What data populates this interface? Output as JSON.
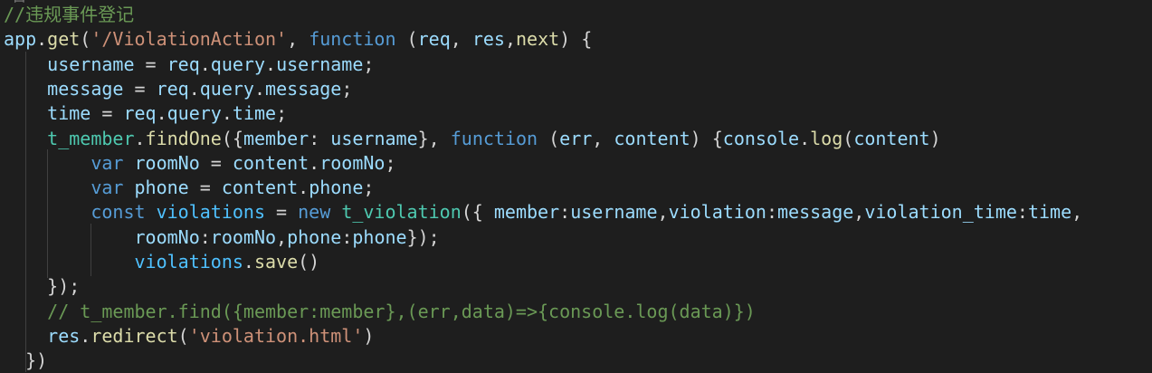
{
  "editor": {
    "top_artifact": "⌐口",
    "lines": [
      {
        "tokens": [
          {
            "t": "//违规事件登记",
            "c": "comment"
          }
        ]
      },
      {
        "tokens": [
          {
            "t": "app",
            "c": "var"
          },
          {
            "t": ".",
            "c": "punc"
          },
          {
            "t": "get",
            "c": "fn"
          },
          {
            "t": "(",
            "c": "punc"
          },
          {
            "t": "'/ViolationAction'",
            "c": "str"
          },
          {
            "t": ", ",
            "c": "punc"
          },
          {
            "t": "function",
            "c": "kw"
          },
          {
            "t": " (",
            "c": "punc"
          },
          {
            "t": "req",
            "c": "param"
          },
          {
            "t": ", ",
            "c": "punc"
          },
          {
            "t": "res",
            "c": "param"
          },
          {
            "t": ",",
            "c": "punc"
          },
          {
            "t": "next",
            "c": "fn"
          },
          {
            "t": ") {",
            "c": "punc"
          }
        ]
      },
      {
        "tokens": [
          {
            "t": "    ",
            "c": "punc"
          },
          {
            "t": "username",
            "c": "var"
          },
          {
            "t": " = ",
            "c": "punc"
          },
          {
            "t": "req",
            "c": "var"
          },
          {
            "t": ".",
            "c": "punc"
          },
          {
            "t": "query",
            "c": "var"
          },
          {
            "t": ".",
            "c": "punc"
          },
          {
            "t": "username",
            "c": "var"
          },
          {
            "t": ";",
            "c": "punc"
          }
        ]
      },
      {
        "tokens": [
          {
            "t": "    ",
            "c": "punc"
          },
          {
            "t": "message",
            "c": "var"
          },
          {
            "t": " = ",
            "c": "punc"
          },
          {
            "t": "req",
            "c": "var"
          },
          {
            "t": ".",
            "c": "punc"
          },
          {
            "t": "query",
            "c": "var"
          },
          {
            "t": ".",
            "c": "punc"
          },
          {
            "t": "message",
            "c": "var"
          },
          {
            "t": ";",
            "c": "punc"
          }
        ]
      },
      {
        "tokens": [
          {
            "t": "    ",
            "c": "punc"
          },
          {
            "t": "time",
            "c": "var"
          },
          {
            "t": " = ",
            "c": "punc"
          },
          {
            "t": "req",
            "c": "var"
          },
          {
            "t": ".",
            "c": "punc"
          },
          {
            "t": "query",
            "c": "var"
          },
          {
            "t": ".",
            "c": "punc"
          },
          {
            "t": "time",
            "c": "var"
          },
          {
            "t": ";",
            "c": "punc"
          }
        ]
      },
      {
        "tokens": [
          {
            "t": "    ",
            "c": "punc"
          },
          {
            "t": "t_member",
            "c": "type"
          },
          {
            "t": ".",
            "c": "punc"
          },
          {
            "t": "findOne",
            "c": "fn"
          },
          {
            "t": "({",
            "c": "punc"
          },
          {
            "t": "member",
            "c": "var"
          },
          {
            "t": ": ",
            "c": "punc"
          },
          {
            "t": "username",
            "c": "var"
          },
          {
            "t": "}, ",
            "c": "punc"
          },
          {
            "t": "function",
            "c": "kw"
          },
          {
            "t": " (",
            "c": "punc"
          },
          {
            "t": "err",
            "c": "param"
          },
          {
            "t": ", ",
            "c": "punc"
          },
          {
            "t": "content",
            "c": "param"
          },
          {
            "t": ") {",
            "c": "punc"
          },
          {
            "t": "console",
            "c": "var"
          },
          {
            "t": ".",
            "c": "punc"
          },
          {
            "t": "log",
            "c": "fn"
          },
          {
            "t": "(",
            "c": "punc"
          },
          {
            "t": "content",
            "c": "var"
          },
          {
            "t": ")",
            "c": "punc"
          }
        ]
      },
      {
        "tokens": [
          {
            "t": "        ",
            "c": "punc"
          },
          {
            "t": "var",
            "c": "kw"
          },
          {
            "t": " ",
            "c": "punc"
          },
          {
            "t": "roomNo",
            "c": "var"
          },
          {
            "t": " = ",
            "c": "punc"
          },
          {
            "t": "content",
            "c": "var"
          },
          {
            "t": ".",
            "c": "punc"
          },
          {
            "t": "roomNo",
            "c": "var"
          },
          {
            "t": ";",
            "c": "punc"
          }
        ]
      },
      {
        "tokens": [
          {
            "t": "        ",
            "c": "punc"
          },
          {
            "t": "var",
            "c": "kw"
          },
          {
            "t": " ",
            "c": "punc"
          },
          {
            "t": "phone",
            "c": "var"
          },
          {
            "t": " = ",
            "c": "punc"
          },
          {
            "t": "content",
            "c": "var"
          },
          {
            "t": ".",
            "c": "punc"
          },
          {
            "t": "phone",
            "c": "var"
          },
          {
            "t": ";",
            "c": "punc"
          }
        ]
      },
      {
        "tokens": [
          {
            "t": "        ",
            "c": "punc"
          },
          {
            "t": "const",
            "c": "kw"
          },
          {
            "t": " ",
            "c": "punc"
          },
          {
            "t": "violations",
            "c": "const"
          },
          {
            "t": " = ",
            "c": "punc"
          },
          {
            "t": "new",
            "c": "kw"
          },
          {
            "t": " ",
            "c": "punc"
          },
          {
            "t": "t_violation",
            "c": "type"
          },
          {
            "t": "({ ",
            "c": "punc"
          },
          {
            "t": "member",
            "c": "var"
          },
          {
            "t": ":",
            "c": "punc"
          },
          {
            "t": "username",
            "c": "var"
          },
          {
            "t": ",",
            "c": "punc"
          },
          {
            "t": "violation",
            "c": "var"
          },
          {
            "t": ":",
            "c": "punc"
          },
          {
            "t": "message",
            "c": "var"
          },
          {
            "t": ",",
            "c": "punc"
          },
          {
            "t": "violation_time",
            "c": "var"
          },
          {
            "t": ":",
            "c": "punc"
          },
          {
            "t": "time",
            "c": "var"
          },
          {
            "t": ",",
            "c": "punc"
          }
        ]
      },
      {
        "tokens": [
          {
            "t": "            ",
            "c": "punc"
          },
          {
            "t": "roomNo",
            "c": "var"
          },
          {
            "t": ":",
            "c": "punc"
          },
          {
            "t": "roomNo",
            "c": "var"
          },
          {
            "t": ",",
            "c": "punc"
          },
          {
            "t": "phone",
            "c": "var"
          },
          {
            "t": ":",
            "c": "punc"
          },
          {
            "t": "phone",
            "c": "var"
          },
          {
            "t": "});",
            "c": "punc"
          }
        ]
      },
      {
        "tokens": [
          {
            "t": "            ",
            "c": "punc"
          },
          {
            "t": "violations",
            "c": "const"
          },
          {
            "t": ".",
            "c": "punc"
          },
          {
            "t": "save",
            "c": "fn"
          },
          {
            "t": "()",
            "c": "punc"
          }
        ]
      },
      {
        "tokens": [
          {
            "t": "    });",
            "c": "punc"
          }
        ]
      },
      {
        "tokens": [
          {
            "t": "    ",
            "c": "punc"
          },
          {
            "t": "// t_member.find({member:member},(err,data)=>{console.log(data)})",
            "c": "comment"
          }
        ]
      },
      {
        "tokens": [
          {
            "t": "    ",
            "c": "punc"
          },
          {
            "t": "res",
            "c": "var"
          },
          {
            "t": ".",
            "c": "punc"
          },
          {
            "t": "redirect",
            "c": "fn"
          },
          {
            "t": "(",
            "c": "punc"
          },
          {
            "t": "'violation.html'",
            "c": "str"
          },
          {
            "t": ")",
            "c": "punc"
          }
        ]
      },
      {
        "tokens": [
          {
            "t": "  })",
            "c": "punc"
          }
        ]
      }
    ]
  }
}
